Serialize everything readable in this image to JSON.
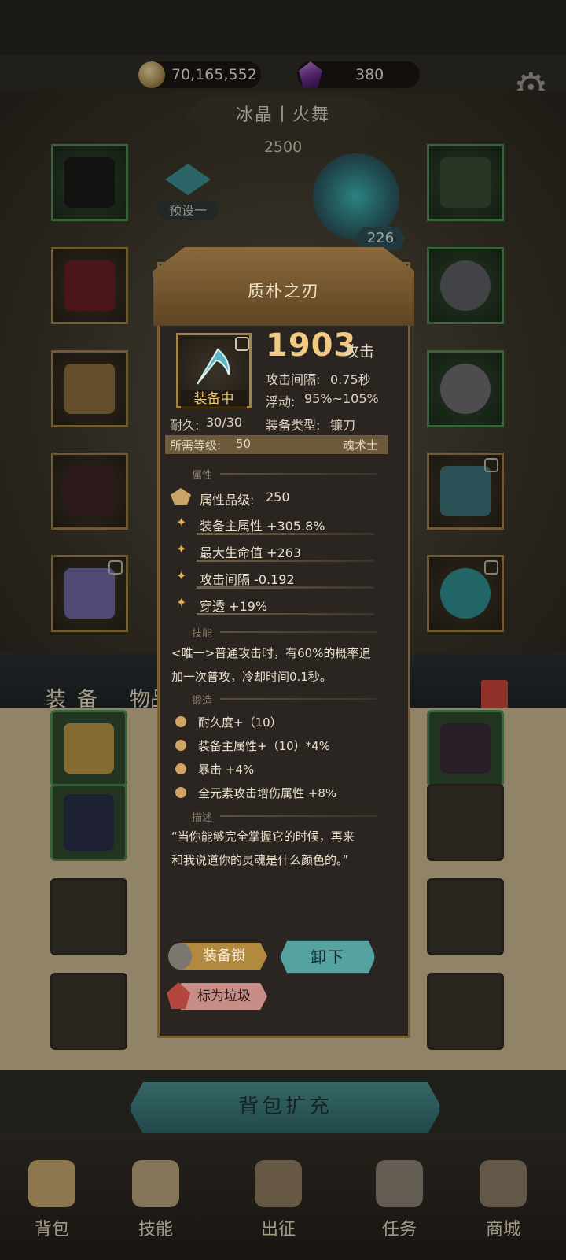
{
  "currency": {
    "gold": "70,165,552",
    "gems": "380"
  },
  "set": {
    "name": "冰晶丨火舞",
    "score": "2500",
    "preset": "预设一"
  },
  "weapon_level_badge": "226",
  "tabs": {
    "equipment": "装备",
    "items": "物品"
  },
  "inventory": {
    "expand_button": "背包扩充"
  },
  "bottom_nav": [
    {
      "label": "背包"
    },
    {
      "label": "技能"
    },
    {
      "label": "出征"
    },
    {
      "label": "任务"
    },
    {
      "label": "商城"
    }
  ],
  "item": {
    "name": "质朴之刃",
    "equipped_label": "装备中",
    "attack_value": "1903",
    "attack_label": "攻击",
    "durability_label": "耐久:",
    "durability_value": "30/30",
    "attack_interval_label": "攻击间隔:",
    "attack_interval_value": "0.75秒",
    "float_label": "浮动:",
    "float_value": "95%~105%",
    "type_label": "装备类型:",
    "type_value": "镰刀",
    "required_level_label": "所需等级:",
    "required_level_value": "50",
    "class": "魂术士"
  },
  "sections": {
    "attributes": "属性",
    "skills": "技能",
    "forging": "锻造",
    "description": "描述"
  },
  "attributes": {
    "quality_label": "属性品级:",
    "quality_value": "250",
    "list": [
      "装备主属性 +305.8%",
      "最大生命值 +263",
      "攻击间隔 -0.192",
      "穿透 +19%"
    ]
  },
  "skill_text_line1": "<唯一>普通攻击时，有60%的概率追",
  "skill_text_line2": "加一次普攻，冷却时间0.1秒。",
  "forging": [
    "耐久度+（10）",
    "装备主属性+（10）*4%",
    "暴击 +4%",
    "全元素攻击增伤属性 +8%"
  ],
  "description_line1": "“当你能够完全掌握它的时候，再来",
  "description_line2": "和我说道你的灵魂是什么颜色的。”",
  "actions": {
    "lock": "装备锁",
    "unequip": "卸下",
    "mark_junk": "标为垃圾"
  },
  "colors": {
    "accent_gold": "#f2c983",
    "teal_button": "#54a3a1",
    "panel_bg": "#2a2520"
  }
}
